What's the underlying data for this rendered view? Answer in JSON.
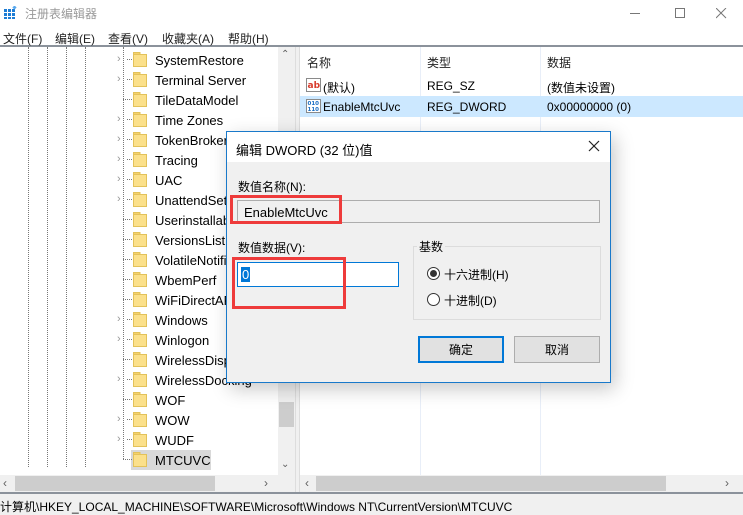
{
  "window": {
    "title": "注册表编辑器",
    "controls": {
      "minimize": "minimize",
      "maximize": "maximize",
      "close": "close"
    }
  },
  "menu": [
    {
      "label": "文件(F)"
    },
    {
      "label": "编辑(E)"
    },
    {
      "label": "查看(V)"
    },
    {
      "label": "收藏夹(A)"
    },
    {
      "label": "帮助(H)"
    }
  ],
  "tree": {
    "items": [
      {
        "label": "SystemRestore",
        "expandable": true
      },
      {
        "label": "Terminal Server",
        "expandable": true
      },
      {
        "label": "TileDataModel",
        "expandable": false
      },
      {
        "label": "Time Zones",
        "expandable": true
      },
      {
        "label": "TokenBroker",
        "expandable": true
      },
      {
        "label": "Tracing",
        "expandable": true
      },
      {
        "label": "UAC",
        "expandable": true
      },
      {
        "label": "UnattendSettings",
        "expandable": true
      },
      {
        "label": "Userinstallable",
        "expandable": false
      },
      {
        "label": "VersionsList",
        "expandable": false
      },
      {
        "label": "VolatileNotifications",
        "expandable": false
      },
      {
        "label": "WbemPerf",
        "expandable": false
      },
      {
        "label": "WiFiDirectAPI",
        "expandable": false
      },
      {
        "label": "Windows",
        "expandable": true
      },
      {
        "label": "Winlogon",
        "expandable": true
      },
      {
        "label": "WirelessDisplay",
        "expandable": false
      },
      {
        "label": "WirelessDocking",
        "expandable": true
      },
      {
        "label": "WOF",
        "expandable": false
      },
      {
        "label": "WOW",
        "expandable": true
      },
      {
        "label": "WUDF",
        "expandable": true
      },
      {
        "label": "MTCUVC",
        "expandable": false,
        "selected": true
      }
    ]
  },
  "list": {
    "columns": [
      "名称",
      "类型",
      "数据"
    ],
    "rows": [
      {
        "icon": "string-value-icon",
        "name": "(默认)",
        "type": "REG_SZ",
        "data": "(数值未设置)"
      },
      {
        "icon": "binary-value-icon",
        "name": "EnableMtcUvc",
        "type": "REG_DWORD",
        "data": "0x00000000 (0)",
        "selected": true
      }
    ]
  },
  "status": {
    "path": "计算机\\HKEY_LOCAL_MACHINE\\SOFTWARE\\Microsoft\\Windows NT\\CurrentVersion\\MTCUVC"
  },
  "dialog": {
    "title": "编辑 DWORD (32 位)值",
    "name_label": "数值名称(N):",
    "name_value": "EnableMtcUvc",
    "data_label": "数值数据(V):",
    "data_value": "0",
    "base_label": "基数",
    "radios": [
      {
        "label": "十六进制(H)",
        "checked": true
      },
      {
        "label": "十进制(D)",
        "checked": false
      }
    ],
    "ok_label": "确定",
    "cancel_label": "取消",
    "highlight_color": "#ee3b3b",
    "accent_color": "#0078d7"
  }
}
